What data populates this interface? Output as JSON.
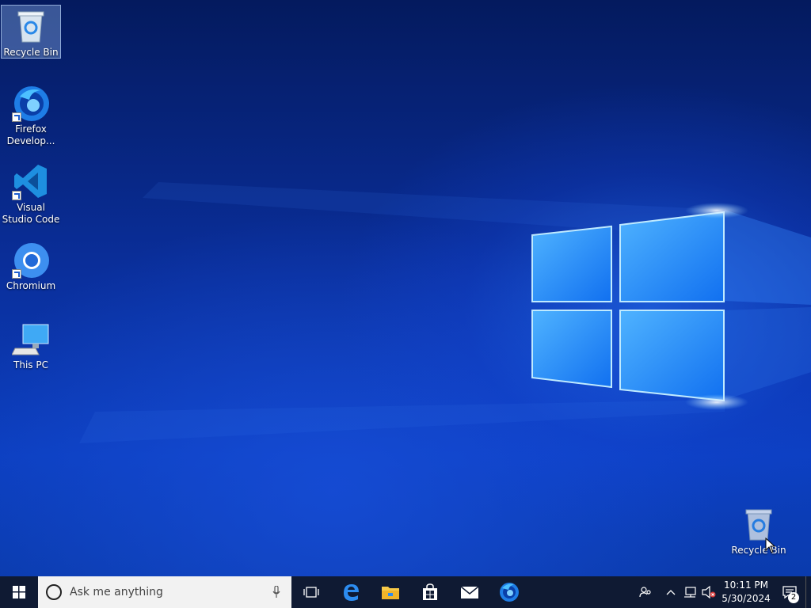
{
  "desktop": {
    "icons": [
      {
        "label": "Recycle Bin",
        "icon": "recycle-bin-icon",
        "selected": true
      },
      {
        "label": "Firefox Develop...",
        "icon": "firefox-developer-icon"
      },
      {
        "label": "Visual Studio Code",
        "icon": "vscode-icon"
      },
      {
        "label": "Chromium",
        "icon": "chromium-icon"
      },
      {
        "label": "This PC",
        "icon": "this-pc-icon"
      }
    ],
    "dragging_icon": {
      "label": "Recycle Bin",
      "icon": "recycle-bin-icon"
    }
  },
  "taskbar": {
    "search_placeholder": "Ask me anything",
    "pinned": [
      "task-view-icon",
      "edge-icon",
      "file-explorer-icon",
      "store-icon",
      "mail-icon",
      "firefox-developer-icon"
    ],
    "clock_time": "10:11 PM",
    "clock_date": "5/30/2024",
    "notification_count": "2"
  },
  "colors": {
    "taskbar_bg": "#0f1a33",
    "search_bg": "#f2f2f2",
    "accent": "#1a86ff"
  }
}
